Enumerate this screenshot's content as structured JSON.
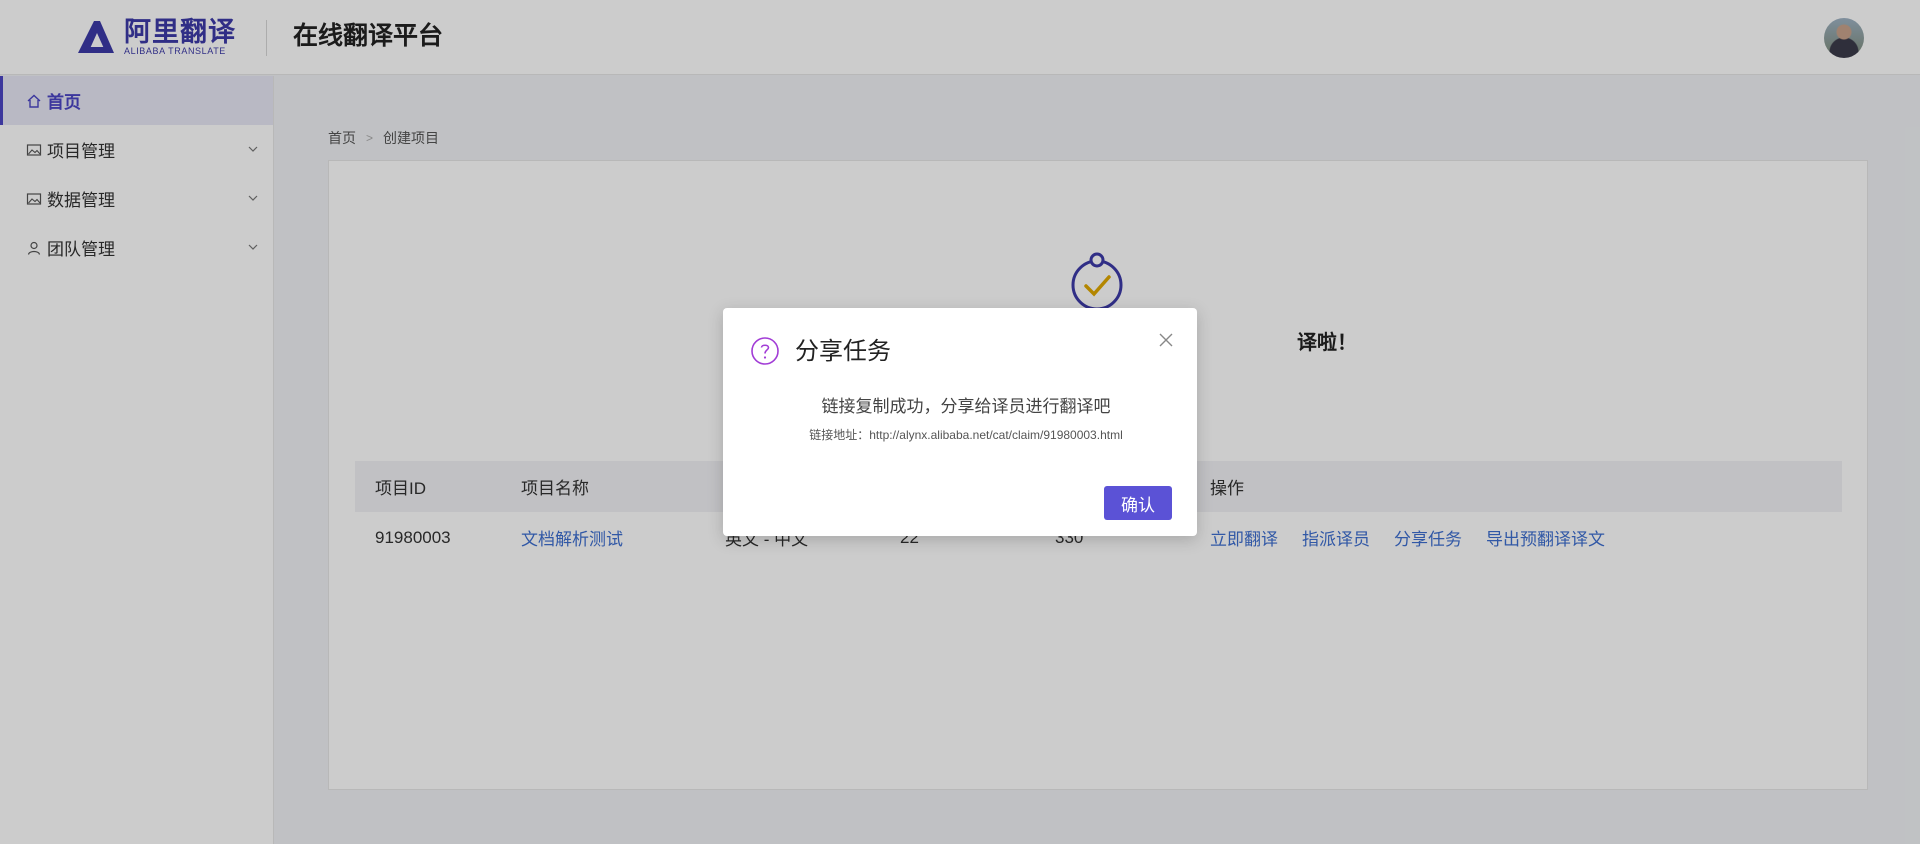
{
  "header": {
    "logo_cn": "阿里翻译",
    "logo_en": "ALIBABA TRANSLATE",
    "platform_title": "在线翻译平台"
  },
  "sidebar": {
    "items": [
      {
        "label": "首页",
        "icon": "home-icon",
        "active": true
      },
      {
        "label": "项目管理",
        "icon": "image-icon",
        "expandable": true
      },
      {
        "label": "数据管理",
        "icon": "image-icon",
        "expandable": true
      },
      {
        "label": "团队管理",
        "icon": "user-icon",
        "expandable": true
      }
    ]
  },
  "breadcrumb": {
    "items": [
      "首页",
      "创建项目"
    ]
  },
  "main": {
    "success_text_visible": "译啦！",
    "table": {
      "headers": [
        "项目ID",
        "项目名称",
        "",
        "",
        "",
        "操作"
      ],
      "rows": [
        {
          "id": "91980003",
          "name": "文档解析测试",
          "lang": "英文 - 中文",
          "col4": "22",
          "col5": "330",
          "actions": [
            "立即翻译",
            "指派译员",
            "分享任务",
            "导出预翻译译文"
          ]
        }
      ]
    }
  },
  "dialog": {
    "title": "分享任务",
    "message": "链接复制成功，分享给译员进行翻译吧",
    "link_text": "链接地址：http://alynx.alibaba.net/cat/claim/91980003.html",
    "confirm_label": "确认"
  },
  "colors": {
    "brand": "#3d3aa8",
    "primary_button": "#5b52d6",
    "link": "#3e6fd0",
    "success_check": "#e0a800"
  }
}
